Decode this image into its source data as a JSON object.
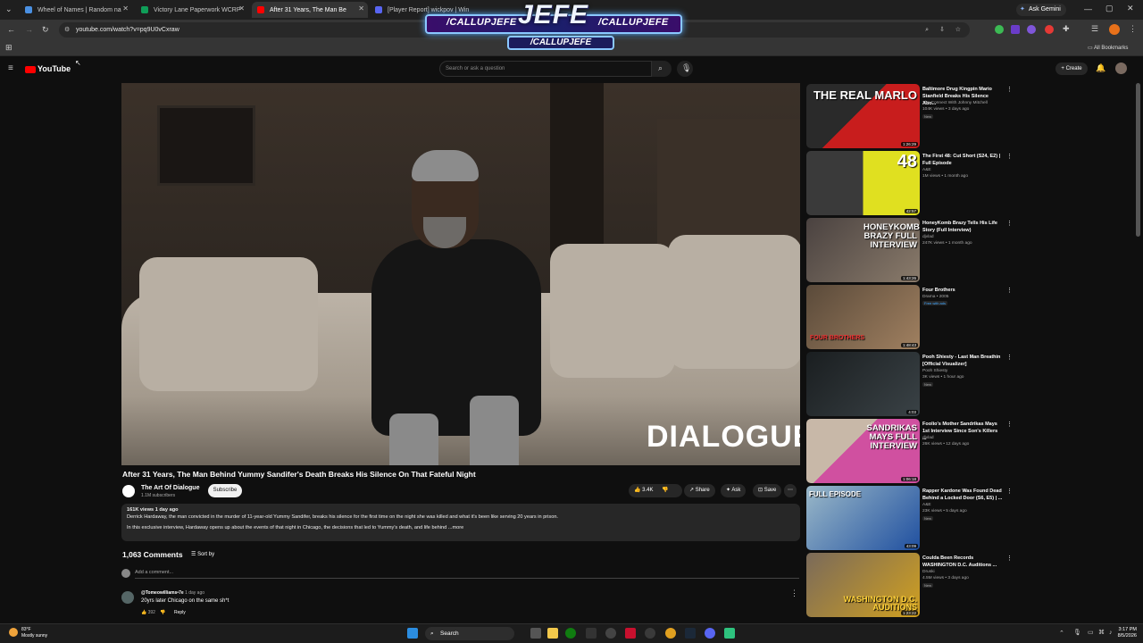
{
  "browser": {
    "tabs": [
      {
        "title": "Wheel of Names | Random na",
        "color": "#4a90e2"
      },
      {
        "title": "Victory Lane Paperwork WCRP",
        "color": "#0f9d58"
      },
      {
        "title": "After 31 Years, The Man Be",
        "color": "#ff0000"
      },
      {
        "title": "[Player Report] wickpov | Win",
        "color": "#5865f2"
      }
    ],
    "url": "youtube.com/watch?v=pq9U0vCxraw",
    "ask_gemini": "Ask Gemini",
    "all_bookmarks": "All Bookmarks"
  },
  "overlay": {
    "handle_left": "/CALLUPJEFE",
    "brand": "JEFE",
    "handle_right": "/CALLUPJEFE",
    "handle_bottom": "/CALLUPJEFE"
  },
  "youtube": {
    "logo": "YouTube",
    "search_placeholder": "Search or ask a question",
    "create": "+ Create"
  },
  "video": {
    "watermark": "DIALOGUE",
    "title": "After 31 Years, The Man Behind Yummy Sandifer's Death Breaks His Silence On That Fateful Night",
    "channel": "The Art Of Dialogue",
    "subscribers": "1.1M subscribers",
    "subscribe": "Subscribe",
    "likes": "3.4K",
    "share": "Share",
    "ask": "Ask",
    "save": "Save",
    "views_date": "161K views  1 day ago",
    "desc_line1": "Derrick Hardaway, the man convicted in the murder of 11-year-old Yummy Sandifer, breaks his silence for the first time on the night she was killed and what it's been like serving 20 years in prison.",
    "desc_line2": "In this exclusive interview, Hardaway opens up about the events of that night in Chicago, the decisions that led to Yummy's death, and life behind ...more"
  },
  "comments": {
    "count": "1,063 Comments",
    "sort": "Sort by",
    "add_placeholder": "Add a comment...",
    "first": {
      "user": "@Tomeowilliams•7e",
      "time": "1 day ago",
      "text": "20yrs later Chicago on the same sh*t",
      "likes": "392",
      "reply": "Reply"
    }
  },
  "recommendations": [
    {
      "title": "Baltimore Drug Kingpin Mario Stanfield Breaks His Silence Abo...",
      "channel": "The Connect With Johnny Mitchell",
      "meta": "104K views • 3 days ago",
      "badge": "New",
      "thumb_text": "THE REAL MARLO",
      "duration": "1:26:29",
      "colors": [
        "#2a2a2a",
        "#c81d1d"
      ]
    },
    {
      "title": "The First 48: Cut Short (S24, E2) | Full Episode",
      "channel": "A&E",
      "meta": "1M views • 1 month ago",
      "badge": "",
      "thumb_text": "48",
      "duration": "42:57",
      "colors": [
        "#3a3a3a",
        "#e0e020"
      ]
    },
    {
      "title": "HoneyKomb Brazy Tells His Life Story (Full Interview)",
      "channel": "djvlad",
      "meta": "247K views • 1 month ago",
      "badge": "",
      "thumb_text": "HONEYKOMB BRAZY FULL INTERVIEW",
      "duration": "1:43:26",
      "colors": [
        "#4a4240",
        "#8a7b6b"
      ]
    },
    {
      "title": "Four Brothers",
      "channel": "Drama • 2005",
      "meta": "",
      "badge": "Free with ads",
      "thumb_text": "FOUR BROTHERS",
      "duration": "1:48:43",
      "colors": [
        "#5a4a3a",
        "#a08060"
      ]
    },
    {
      "title": "Pooh Shiesty - Last Man Breathin [Official Visualizer]",
      "channel": "Pooh Shiesty",
      "meta": "3K views • 1 hour ago",
      "badge": "New",
      "thumb_text": "",
      "duration": "4:03",
      "colors": [
        "#1a1e20",
        "#3a4246"
      ]
    },
    {
      "title": "Foolio's Mother Sandrikas Mays 1st Interview Since Son's Killers ...",
      "channel": "djvlad",
      "meta": "26K views • 12 days ago",
      "badge": "",
      "thumb_text": "SANDRIKAS MAYS FULL INTERVIEW",
      "duration": "1:06:18",
      "colors": [
        "#c8b8a8",
        "#d050a0"
      ]
    },
    {
      "title": "Rapper Kardone Was Found Dead Behind a Locked Door (S6, E5) | ...",
      "channel": "A&E",
      "meta": "23K views • 5 days ago",
      "badge": "New",
      "thumb_text": "FULL EPISODE",
      "duration": "43:09",
      "colors": [
        "#9ab8c8",
        "#2050a0"
      ]
    },
    {
      "title": "Coulda Been Records WASHINGTON D.C. Auditions ...",
      "channel": "Druski",
      "meta": "4.5M views • 3 days ago",
      "badge": "New",
      "thumb_text": "WASHINGTON D.C. AUDITIONS",
      "duration": "1:23:22",
      "colors": [
        "#7a6a5a",
        "#d0a020"
      ]
    }
  ],
  "taskbar": {
    "temp": "83°F",
    "weather": "Mostly sunny",
    "search": "Search",
    "time": "3:17 PM",
    "date": "8/5/2026"
  }
}
